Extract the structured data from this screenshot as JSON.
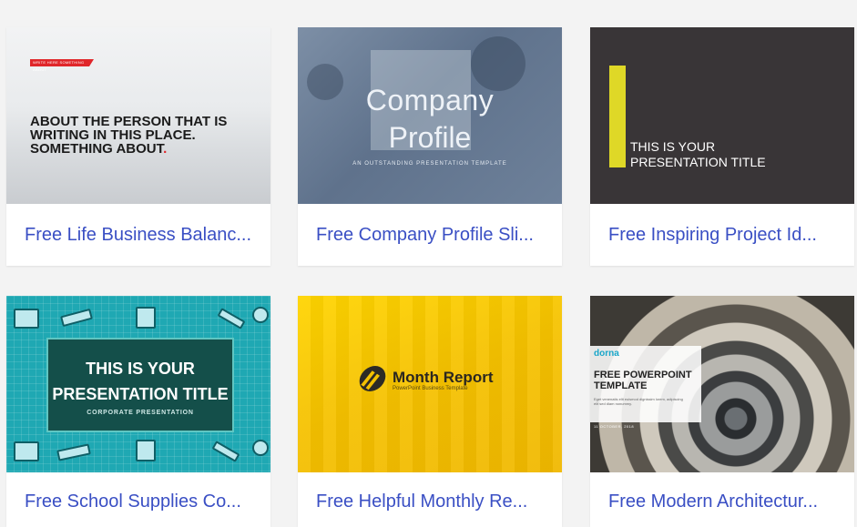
{
  "cards": [
    {
      "title": "Free Life Business Balanc...",
      "thumb": {
        "tag": "WRITE HERE SOMETHING ABOUT",
        "headline": "ABOUT THE PERSON THAT IS WRITING IN THIS PLACE. SOMETHING ABOUT",
        "headline_dot": "."
      }
    },
    {
      "title": "Free Company Profile Sli...",
      "thumb": {
        "line1": "Company",
        "line2": "Profile",
        "subtitle": "AN OUTSTANDING PRESENTATION TEMPLATE"
      }
    },
    {
      "title": "Free Inspiring Project Id...",
      "thumb": {
        "line1": "THIS IS YOUR",
        "line2": "PRESENTATION TITLE"
      }
    },
    {
      "title": "Free School Supplies Co...",
      "thumb": {
        "line1": "THIS IS YOUR",
        "line2": "PRESENTATION TITLE",
        "subtitle": "CORPORATE PRESENTATION"
      }
    },
    {
      "title": "Free Helpful Monthly Re...",
      "thumb": {
        "title": "Month Report",
        "subtitle": "PowerPoint Business Template"
      }
    },
    {
      "title": "Free Modern Architectur...",
      "thumb": {
        "brand": "dorna",
        "heading1": "FREE POWERPOINT",
        "heading2": "TEMPLATE",
        "body": "Eget venenatis elit euismod dignissim lorem, adipiscing elit sed diam nonummy.",
        "date": "11 OCTOBER, 2018"
      }
    }
  ],
  "colors": {
    "link": "#3a4fc4",
    "background": "#f3f3f3",
    "accent_red": "#e0262a",
    "accent_yellow": "#dfd827"
  }
}
